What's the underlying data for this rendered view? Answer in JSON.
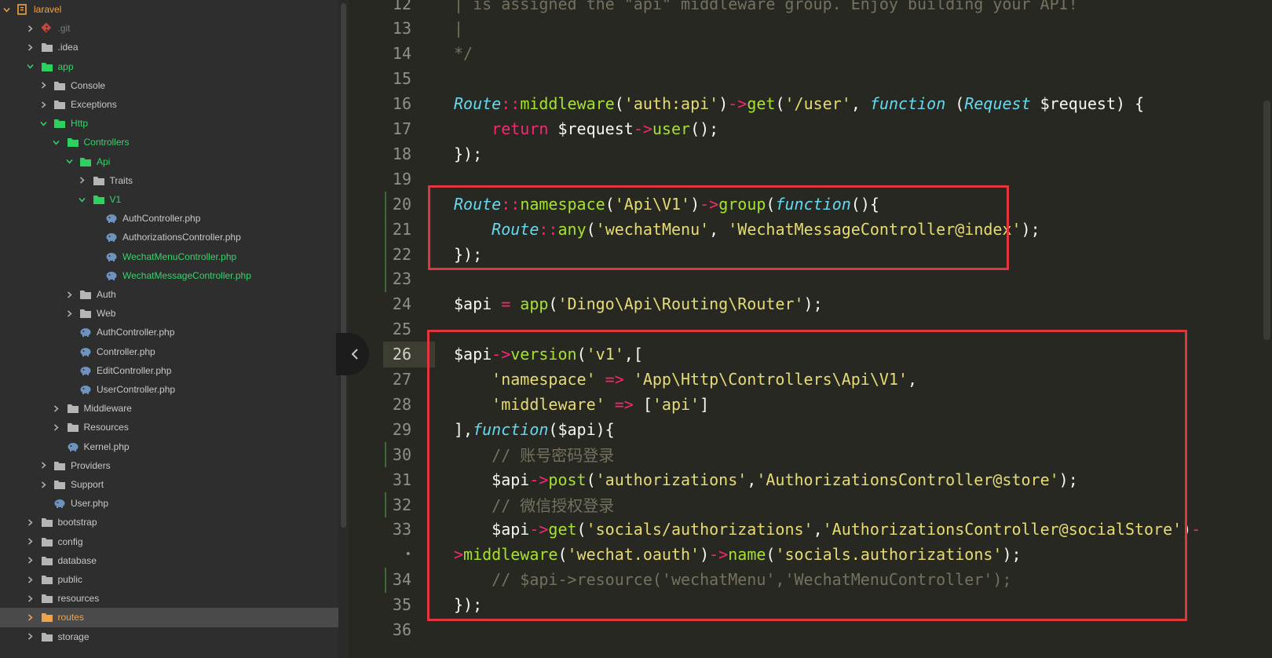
{
  "sidebar": {
    "items": [
      {
        "label": "laravel",
        "depth": 0,
        "expanded": true,
        "icon": "project-icon",
        "name": "tree-item-laravel",
        "style": "orange"
      },
      {
        "label": ".git",
        "depth": 1,
        "expanded": false,
        "icon": "git-icon",
        "name": "tree-item-git",
        "style": "dim"
      },
      {
        "label": ".idea",
        "depth": 1,
        "expanded": false,
        "icon": "folder-icon",
        "name": "tree-item-idea",
        "style": ""
      },
      {
        "label": "app",
        "depth": 1,
        "expanded": true,
        "icon": "folder-open-icon",
        "name": "tree-item-app",
        "style": "green"
      },
      {
        "label": "Console",
        "depth": 2,
        "expanded": false,
        "icon": "folder-icon",
        "name": "tree-item-console",
        "style": ""
      },
      {
        "label": "Exceptions",
        "depth": 2,
        "expanded": false,
        "icon": "folder-icon",
        "name": "tree-item-exceptions",
        "style": ""
      },
      {
        "label": "Http",
        "depth": 2,
        "expanded": true,
        "icon": "folder-open-icon",
        "name": "tree-item-http",
        "style": "green"
      },
      {
        "label": "Controllers",
        "depth": 3,
        "expanded": true,
        "icon": "folder-open-icon",
        "name": "tree-item-controllers",
        "style": "green"
      },
      {
        "label": "Api",
        "depth": 4,
        "expanded": true,
        "icon": "folder-open-icon",
        "name": "tree-item-api",
        "style": "green"
      },
      {
        "label": "Traits",
        "depth": 5,
        "expanded": false,
        "icon": "folder-icon",
        "name": "tree-item-traits",
        "style": ""
      },
      {
        "label": "V1",
        "depth": 5,
        "expanded": true,
        "icon": "folder-open-icon",
        "name": "tree-item-v1",
        "style": "green"
      },
      {
        "label": "AuthController.php",
        "depth": 6,
        "file": true,
        "icon": "php-file-icon",
        "name": "tree-item-v1-authcontroller",
        "style": ""
      },
      {
        "label": "AuthorizationsController.php",
        "depth": 6,
        "file": true,
        "icon": "php-file-icon",
        "name": "tree-item-authorizationscontroller",
        "style": ""
      },
      {
        "label": "WechatMenuController.php",
        "depth": 6,
        "file": true,
        "icon": "php-file-icon",
        "name": "tree-item-wechatmenucontroller",
        "style": "green"
      },
      {
        "label": "WechatMessageController.php",
        "depth": 6,
        "file": true,
        "icon": "php-file-icon",
        "name": "tree-item-wechatmessagecontroller",
        "style": "green"
      },
      {
        "label": "Auth",
        "depth": 4,
        "expanded": false,
        "icon": "folder-icon",
        "name": "tree-item-auth",
        "style": ""
      },
      {
        "label": "Web",
        "depth": 4,
        "expanded": false,
        "icon": "folder-icon",
        "name": "tree-item-web",
        "style": ""
      },
      {
        "label": "AuthController.php",
        "depth": 4,
        "file": true,
        "icon": "php-file-icon",
        "name": "tree-item-authcontroller",
        "style": ""
      },
      {
        "label": "Controller.php",
        "depth": 4,
        "file": true,
        "icon": "php-file-icon",
        "name": "tree-item-controller",
        "style": ""
      },
      {
        "label": "EditController.php",
        "depth": 4,
        "file": true,
        "icon": "php-file-icon",
        "name": "tree-item-editcontroller",
        "style": ""
      },
      {
        "label": "UserController.php",
        "depth": 4,
        "file": true,
        "icon": "php-file-icon",
        "name": "tree-item-usercontroller",
        "style": ""
      },
      {
        "label": "Middleware",
        "depth": 3,
        "expanded": false,
        "icon": "folder-icon",
        "name": "tree-item-middleware",
        "style": ""
      },
      {
        "label": "Resources",
        "depth": 3,
        "expanded": false,
        "icon": "folder-icon",
        "name": "tree-item-resources-http",
        "style": ""
      },
      {
        "label": "Kernel.php",
        "depth": 3,
        "file": true,
        "icon": "php-file-icon",
        "name": "tree-item-kernel",
        "style": ""
      },
      {
        "label": "Providers",
        "depth": 2,
        "expanded": false,
        "icon": "folder-icon",
        "name": "tree-item-providers",
        "style": ""
      },
      {
        "label": "Support",
        "depth": 2,
        "expanded": false,
        "icon": "folder-icon",
        "name": "tree-item-support",
        "style": ""
      },
      {
        "label": "User.php",
        "depth": 2,
        "file": true,
        "icon": "php-file-icon",
        "name": "tree-item-user",
        "style": ""
      },
      {
        "label": "bootstrap",
        "depth": 1,
        "expanded": false,
        "icon": "folder-icon",
        "name": "tree-item-bootstrap",
        "style": ""
      },
      {
        "label": "config",
        "depth": 1,
        "expanded": false,
        "icon": "folder-icon",
        "name": "tree-item-config",
        "style": ""
      },
      {
        "label": "database",
        "depth": 1,
        "expanded": false,
        "icon": "folder-icon",
        "name": "tree-item-database",
        "style": ""
      },
      {
        "label": "public",
        "depth": 1,
        "expanded": false,
        "icon": "folder-icon",
        "name": "tree-item-public",
        "style": ""
      },
      {
        "label": "resources",
        "depth": 1,
        "expanded": false,
        "icon": "folder-icon",
        "name": "tree-item-resources",
        "style": ""
      },
      {
        "label": "routes",
        "depth": 1,
        "expanded": false,
        "icon": "folder-orange-icon",
        "name": "tree-item-routes",
        "style": "orange",
        "selected": true
      },
      {
        "label": "storage",
        "depth": 1,
        "expanded": false,
        "icon": "folder-icon",
        "name": "tree-item-storage",
        "style": ""
      }
    ]
  },
  "editor": {
    "active_line": "26",
    "lines": [
      {
        "num": "12",
        "tokens": [
          {
            "t": "| is assigned the \"api\" middleware group. Enjoy building your API!",
            "c": "cmt"
          }
        ]
      },
      {
        "num": "13",
        "tokens": [
          {
            "t": "|",
            "c": "cmt"
          }
        ]
      },
      {
        "num": "14",
        "tokens": [
          {
            "t": "*/",
            "c": "cmt"
          }
        ]
      },
      {
        "num": "15",
        "tokens": []
      },
      {
        "num": "16",
        "tokens": [
          {
            "t": "Route",
            "c": "cls"
          },
          {
            "t": "::",
            "c": "op"
          },
          {
            "t": "middleware",
            "c": "fn"
          },
          {
            "t": "(",
            "c": "pl"
          },
          {
            "t": "'auth:api'",
            "c": "str"
          },
          {
            "t": ")",
            "c": "pl"
          },
          {
            "t": "->",
            "c": "op"
          },
          {
            "t": "get",
            "c": "fn"
          },
          {
            "t": "(",
            "c": "pl"
          },
          {
            "t": "'/user'",
            "c": "str"
          },
          {
            "t": ", ",
            "c": "pl"
          },
          {
            "t": "function",
            "c": "kw"
          },
          {
            "t": " (",
            "c": "pl"
          },
          {
            "t": "Request",
            "c": "cls"
          },
          {
            "t": " $request) {",
            "c": "pl"
          }
        ]
      },
      {
        "num": "17",
        "tokens": [
          {
            "t": "    ",
            "c": "pl"
          },
          {
            "t": "return",
            "c": "ret"
          },
          {
            "t": " $request",
            "c": "pl"
          },
          {
            "t": "->",
            "c": "op"
          },
          {
            "t": "user",
            "c": "fn"
          },
          {
            "t": "();",
            "c": "pl"
          }
        ]
      },
      {
        "num": "18",
        "tokens": [
          {
            "t": "});",
            "c": "pl"
          }
        ]
      },
      {
        "num": "19",
        "tokens": []
      },
      {
        "num": "20",
        "tokens": [
          {
            "t": "Route",
            "c": "cls"
          },
          {
            "t": "::",
            "c": "op"
          },
          {
            "t": "namespace",
            "c": "fn"
          },
          {
            "t": "(",
            "c": "pl"
          },
          {
            "t": "'Api\\V1'",
            "c": "str"
          },
          {
            "t": ")",
            "c": "pl"
          },
          {
            "t": "->",
            "c": "op"
          },
          {
            "t": "group",
            "c": "fn"
          },
          {
            "t": "(",
            "c": "pl"
          },
          {
            "t": "function",
            "c": "kw"
          },
          {
            "t": "(){",
            "c": "pl"
          }
        ]
      },
      {
        "num": "21",
        "tokens": [
          {
            "t": "    ",
            "c": "pl"
          },
          {
            "t": "Route",
            "c": "cls"
          },
          {
            "t": "::",
            "c": "op"
          },
          {
            "t": "any",
            "c": "fn"
          },
          {
            "t": "(",
            "c": "pl"
          },
          {
            "t": "'wechatMenu'",
            "c": "str"
          },
          {
            "t": ", ",
            "c": "pl"
          },
          {
            "t": "'WechatMessageController@index'",
            "c": "str"
          },
          {
            "t": ");",
            "c": "pl"
          }
        ]
      },
      {
        "num": "22",
        "tokens": [
          {
            "t": "});",
            "c": "pl"
          }
        ]
      },
      {
        "num": "23",
        "tokens": []
      },
      {
        "num": "24",
        "tokens": [
          {
            "t": "$api",
            "c": "pl"
          },
          {
            "t": " = ",
            "c": "op"
          },
          {
            "t": "app",
            "c": "fn"
          },
          {
            "t": "(",
            "c": "pl"
          },
          {
            "t": "'Dingo\\Api\\Routing\\Router'",
            "c": "str"
          },
          {
            "t": ");",
            "c": "pl"
          }
        ]
      },
      {
        "num": "25",
        "tokens": []
      },
      {
        "num": "26",
        "tokens": [
          {
            "t": "$api",
            "c": "pl"
          },
          {
            "t": "->",
            "c": "op"
          },
          {
            "t": "version",
            "c": "fn"
          },
          {
            "t": "(",
            "c": "pl"
          },
          {
            "t": "'v1'",
            "c": "str"
          },
          {
            "t": ",[",
            "c": "pl"
          }
        ]
      },
      {
        "num": "27",
        "tokens": [
          {
            "t": "    ",
            "c": "pl"
          },
          {
            "t": "'namespace'",
            "c": "str"
          },
          {
            "t": " => ",
            "c": "op"
          },
          {
            "t": "'App\\Http\\Controllers\\Api\\V1'",
            "c": "str"
          },
          {
            "t": ",",
            "c": "pl"
          }
        ]
      },
      {
        "num": "28",
        "tokens": [
          {
            "t": "    ",
            "c": "pl"
          },
          {
            "t": "'middleware'",
            "c": "str"
          },
          {
            "t": " => ",
            "c": "op"
          },
          {
            "t": "[",
            "c": "pl"
          },
          {
            "t": "'api'",
            "c": "str"
          },
          {
            "t": "]",
            "c": "pl"
          }
        ]
      },
      {
        "num": "29",
        "tokens": [
          {
            "t": "],",
            "c": "pl"
          },
          {
            "t": "function",
            "c": "kw"
          },
          {
            "t": "($api){",
            "c": "pl"
          }
        ]
      },
      {
        "num": "30",
        "tokens": [
          {
            "t": "    ",
            "c": "pl"
          },
          {
            "t": "// 账号密码登录",
            "c": "cmt"
          }
        ]
      },
      {
        "num": "31",
        "tokens": [
          {
            "t": "    $api",
            "c": "pl"
          },
          {
            "t": "->",
            "c": "op"
          },
          {
            "t": "post",
            "c": "fn"
          },
          {
            "t": "(",
            "c": "pl"
          },
          {
            "t": "'authorizations'",
            "c": "str"
          },
          {
            "t": ",",
            "c": "pl"
          },
          {
            "t": "'AuthorizationsController@store'",
            "c": "str"
          },
          {
            "t": ");",
            "c": "pl"
          }
        ]
      },
      {
        "num": "32",
        "tokens": [
          {
            "t": "    ",
            "c": "pl"
          },
          {
            "t": "// 微信授权登录",
            "c": "cmt"
          }
        ]
      },
      {
        "num": "33",
        "tokens": [
          {
            "t": "    $api",
            "c": "pl"
          },
          {
            "t": "->",
            "c": "op"
          },
          {
            "t": "get",
            "c": "fn"
          },
          {
            "t": "(",
            "c": "pl"
          },
          {
            "t": "'socials/authorizations'",
            "c": "str"
          },
          {
            "t": ",",
            "c": "pl"
          },
          {
            "t": "'AuthorizationsController@socialStore'",
            "c": "str"
          },
          {
            "t": ")",
            "c": "pl"
          },
          {
            "t": "-",
            "c": "op"
          }
        ]
      },
      {
        "num": "•",
        "tokens": [
          {
            "t": ">",
            "c": "op"
          },
          {
            "t": "middleware",
            "c": "fn"
          },
          {
            "t": "(",
            "c": "pl"
          },
          {
            "t": "'wechat.oauth'",
            "c": "str"
          },
          {
            "t": ")",
            "c": "pl"
          },
          {
            "t": "->",
            "c": "op"
          },
          {
            "t": "name",
            "c": "fn"
          },
          {
            "t": "(",
            "c": "pl"
          },
          {
            "t": "'socials.authorizations'",
            "c": "str"
          },
          {
            "t": ");",
            "c": "pl"
          }
        ]
      },
      {
        "num": "34",
        "tokens": [
          {
            "t": "    ",
            "c": "pl"
          },
          {
            "t": "// $api->resource('wechatMenu','WechatMenuController');",
            "c": "cmt"
          }
        ]
      },
      {
        "num": "35",
        "tokens": [
          {
            "t": "});",
            "c": "pl"
          }
        ]
      },
      {
        "num": "36",
        "tokens": []
      }
    ]
  },
  "colors": {
    "comment": "#75715e",
    "string": "#e6db74",
    "function": "#a6e22e",
    "class": "#66d9ef",
    "operator": "#f92672",
    "highlight_box": "#e0363d",
    "green_label": "#35d46a",
    "orange_label": "#f0a24a"
  }
}
